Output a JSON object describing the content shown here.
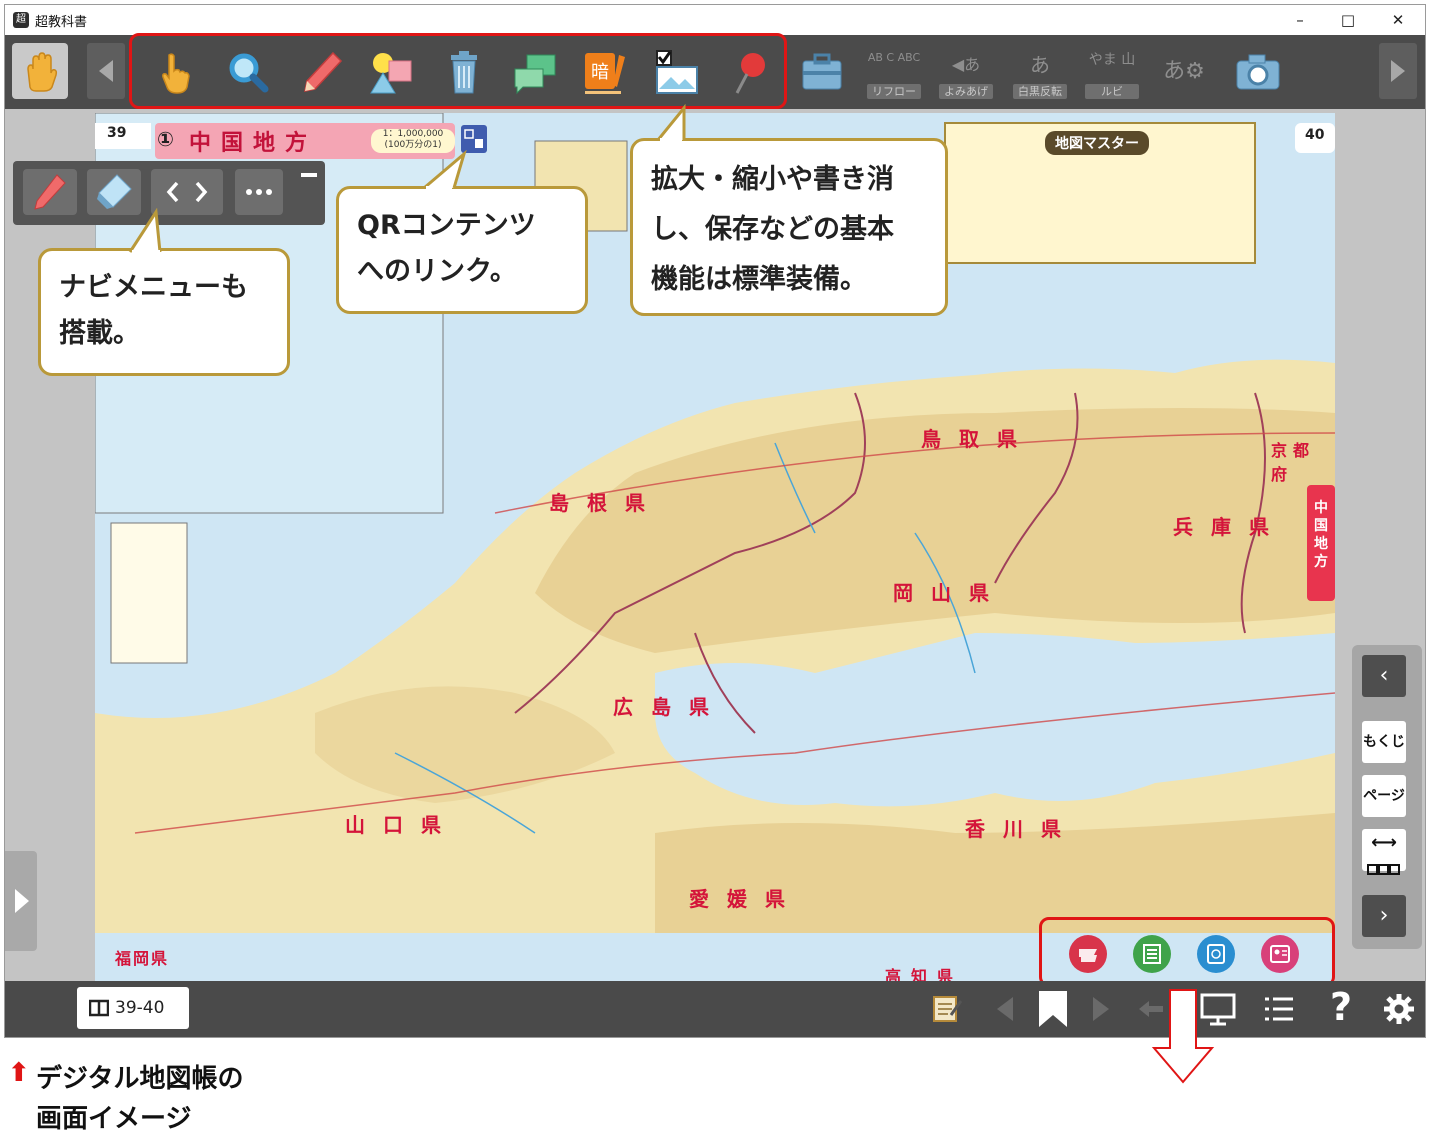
{
  "window": {
    "title": "超教科書",
    "minimize": "–",
    "maximize": "□",
    "close": "✕"
  },
  "toolbar": {
    "gray_tools": [
      {
        "top": "AB C ABC",
        "label": "リフロー"
      },
      {
        "top": "◀あ",
        "label": "よみあげ"
      },
      {
        "top": "あ",
        "label": "白黒反転"
      },
      {
        "top": "やま 山",
        "label": "ルビ"
      },
      {
        "top": "あ⚙",
        "label": ""
      }
    ]
  },
  "callouts": {
    "navi": {
      "line1": "ナビメニューも",
      "line2": "搭載。"
    },
    "qr": {
      "line1": "QRコンテンツ",
      "line2": "へのリンク。"
    },
    "basic": {
      "line1": "拡大・縮小や書き消",
      "line2": "し、保存などの基本",
      "line3": "機能は標準装備。"
    }
  },
  "map": {
    "page_left": "39",
    "page_right": "40",
    "title_num": "①",
    "title": "中国地方",
    "scale": "1：1,000,000",
    "scale_sub": "(100万分の1)",
    "side_tab": "中国地方",
    "master_title": "地図マスター",
    "prefectures": [
      "島根県",
      "鳥取県",
      "岡山県",
      "広島県",
      "山口県",
      "兵庫県",
      "香川県",
      "愛媛県",
      "京都府",
      "福岡県",
      "高知県"
    ]
  },
  "right_panel": {
    "prev": "‹",
    "toc": "もくじ",
    "page": "ページ",
    "spread": "⟷",
    "next": "›"
  },
  "bottom": {
    "pages": "39-40",
    "help": "?"
  },
  "caption": {
    "arrow": "⬆",
    "line1": "デジタル地図帳の",
    "line2": "画面イメージ"
  },
  "colors": {
    "toolbar": "#4b4b4b",
    "accent_red": "#e01515",
    "callout_border": "#b9993a",
    "map_land": "#f3e6b5",
    "sea": "#cfe6f4"
  }
}
